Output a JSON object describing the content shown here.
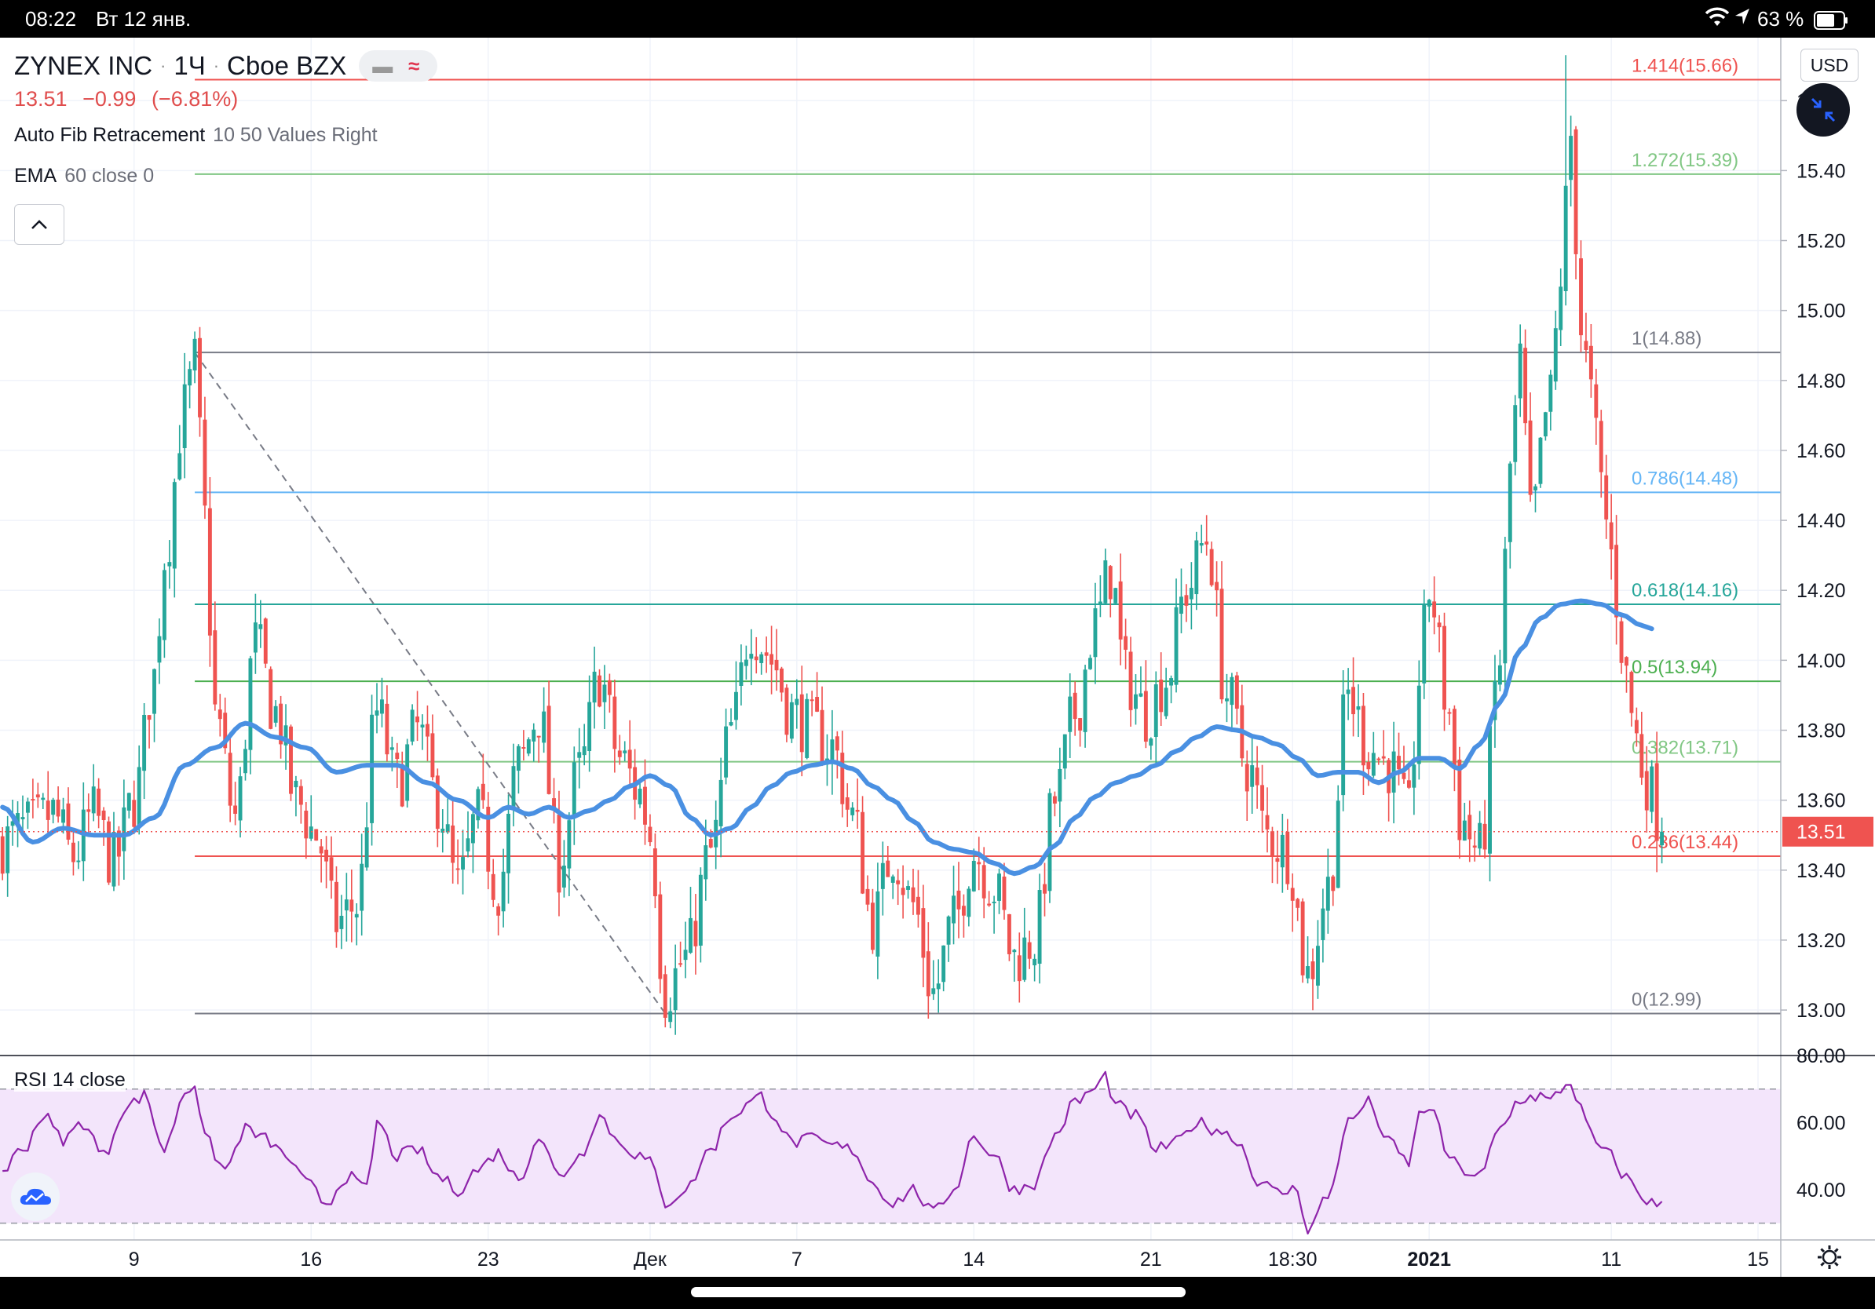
{
  "status_bar": {
    "time": "08:22",
    "date": "Вт 12 янв.",
    "battery": "63 %",
    "icons": [
      "wifi-icon",
      "location-arrow-icon",
      "battery-icon"
    ]
  },
  "header": {
    "symbol": "ZYNEX INC",
    "interval": "1Ч",
    "exchange": "Cboe BZX",
    "last_price": "13.51",
    "change": "−0.99",
    "change_pct": "(−6.81%)",
    "indicators": [
      {
        "name": "Auto Fib Retracement",
        "params": "10 50 Values Right"
      },
      {
        "name": "EMA",
        "params": "60 close 0"
      }
    ],
    "rsi": {
      "name": "RSI",
      "params": "14 close"
    }
  },
  "controls": {
    "currency": "USD",
    "collapse": "^"
  },
  "colors": {
    "up": "#26a69a",
    "down": "#ef5350",
    "ema": "#4a90e2",
    "rsi": "#8e24aa",
    "rsi_band": "#f3e5fb"
  },
  "chart_data": {
    "type": "candlestick",
    "title": "ZYNEX INC · 1Ч · Cboe BZX",
    "ylim": [
      12.87,
      15.78
    ],
    "y_ticks": [
      13.0,
      13.2,
      13.4,
      13.6,
      13.8,
      14.0,
      14.2,
      14.4,
      14.6,
      14.8,
      15.0,
      15.2,
      15.4,
      15.6
    ],
    "y_tick_labels": [
      "13.00",
      "13.20",
      "13.40",
      "13.60",
      "13.80",
      "14.00",
      "14.20",
      "14.40",
      "14.60",
      "14.80",
      "15.00",
      "15.20",
      "15.40",
      "15.60"
    ],
    "x_ticks": [
      {
        "label": "9",
        "bar": 26
      },
      {
        "label": "16",
        "bar": 61
      },
      {
        "label": "23",
        "bar": 96
      },
      {
        "label": "Дек",
        "bar": 128
      },
      {
        "label": "7",
        "bar": 157
      },
      {
        "label": "14",
        "bar": 192
      },
      {
        "label": "21",
        "bar": 227
      },
      {
        "label": "18:30",
        "bar": 255
      },
      {
        "label": "2021",
        "bar": 282,
        "bold": true
      },
      {
        "label": "11",
        "bar": 318
      },
      {
        "label": "15",
        "bar": 347
      }
    ],
    "last_price": 13.51,
    "last_price_label": "13.51",
    "fib_levels": [
      {
        "level": "1.414",
        "price": 15.66,
        "label": "1.414(15.66)",
        "color": "#ef5350"
      },
      {
        "level": "1.272",
        "price": 15.39,
        "label": "1.272(15.39)",
        "color": "#81c784"
      },
      {
        "level": "1",
        "price": 14.88,
        "label": "1(14.88)",
        "color": "#787b86"
      },
      {
        "level": "0.786",
        "price": 14.48,
        "label": "0.786(14.48)",
        "color": "#64b5f6"
      },
      {
        "level": "0.618",
        "price": 14.16,
        "label": "0.618(14.16)",
        "color": "#26a69a"
      },
      {
        "level": "0.5",
        "price": 13.94,
        "label": "0.5(13.94)",
        "color": "#4caf50"
      },
      {
        "level": "0.382",
        "price": 13.71,
        "label": "0.382(13.71)",
        "color": "#81c784"
      },
      {
        "level": "0.236",
        "price": 13.44,
        "label": "0.236(13.44)",
        "color": "#ef5350"
      },
      {
        "level": "0",
        "price": 12.99,
        "label": "0(12.99)",
        "color": "#787b86"
      }
    ],
    "fib_trend": {
      "from": {
        "bar": 38,
        "price": 14.88
      },
      "to": {
        "bar": 131,
        "price": 12.99
      }
    },
    "price_anchors": [
      [
        0,
        13.48
      ],
      [
        5,
        13.52
      ],
      [
        10,
        13.56
      ],
      [
        14,
        13.44
      ],
      [
        18,
        13.56
      ],
      [
        22,
        13.42
      ],
      [
        26,
        13.6
      ],
      [
        30,
        13.95
      ],
      [
        32,
        14.3
      ],
      [
        36,
        14.72
      ],
      [
        38,
        14.85
      ],
      [
        40,
        14.4
      ],
      [
        42,
        13.85
      ],
      [
        46,
        13.55
      ],
      [
        50,
        14.05
      ],
      [
        54,
        13.85
      ],
      [
        58,
        13.6
      ],
      [
        62,
        13.5
      ],
      [
        66,
        13.25
      ],
      [
        70,
        13.3
      ],
      [
        74,
        13.85
      ],
      [
        78,
        13.65
      ],
      [
        82,
        13.8
      ],
      [
        86,
        13.6
      ],
      [
        90,
        13.35
      ],
      [
        94,
        13.55
      ],
      [
        98,
        13.35
      ],
      [
        102,
        13.7
      ],
      [
        106,
        13.85
      ],
      [
        110,
        13.42
      ],
      [
        114,
        13.68
      ],
      [
        118,
        13.95
      ],
      [
        122,
        13.72
      ],
      [
        126,
        13.62
      ],
      [
        128,
        13.5
      ],
      [
        131,
        13.05
      ],
      [
        135,
        13.15
      ],
      [
        140,
        13.45
      ],
      [
        144,
        13.8
      ],
      [
        148,
        14.1
      ],
      [
        150,
        14.05
      ],
      [
        152,
        14.0
      ],
      [
        156,
        13.85
      ],
      [
        160,
        13.8
      ],
      [
        164,
        13.75
      ],
      [
        168,
        13.55
      ],
      [
        172,
        13.25
      ],
      [
        176,
        13.45
      ],
      [
        180,
        13.3
      ],
      [
        184,
        13.05
      ],
      [
        188,
        13.25
      ],
      [
        192,
        13.45
      ],
      [
        196,
        13.35
      ],
      [
        200,
        13.15
      ],
      [
        204,
        13.2
      ],
      [
        208,
        13.6
      ],
      [
        212,
        13.85
      ],
      [
        216,
        14.1
      ],
      [
        219,
        14.25
      ],
      [
        222,
        13.95
      ],
      [
        226,
        13.85
      ],
      [
        230,
        13.95
      ],
      [
        234,
        14.2
      ],
      [
        238,
        14.35
      ],
      [
        242,
        13.9
      ],
      [
        246,
        13.7
      ],
      [
        250,
        13.5
      ],
      [
        254,
        13.45
      ],
      [
        258,
        13.1
      ],
      [
        262,
        13.35
      ],
      [
        266,
        13.9
      ],
      [
        270,
        13.75
      ],
      [
        274,
        13.7
      ],
      [
        278,
        13.55
      ],
      [
        280,
        13.95
      ],
      [
        282,
        14.2
      ],
      [
        286,
        13.85
      ],
      [
        288,
        13.55
      ],
      [
        292,
        13.45
      ],
      [
        296,
        14.0
      ],
      [
        298,
        14.55
      ],
      [
        300,
        14.85
      ],
      [
        302,
        14.4
      ],
      [
        306,
        14.75
      ],
      [
        308,
        15.1
      ],
      [
        310,
        15.5
      ],
      [
        312,
        14.95
      ],
      [
        314,
        14.75
      ],
      [
        316,
        14.5
      ],
      [
        318,
        14.3
      ],
      [
        320,
        14.05
      ],
      [
        322,
        13.85
      ],
      [
        324,
        13.7
      ],
      [
        326,
        13.62
      ],
      [
        328,
        13.51
      ]
    ],
    "spike": {
      "bar": 309,
      "high": 15.73,
      "low": 14.9
    },
    "ema_anchors": [
      [
        0,
        13.58
      ],
      [
        6,
        13.48
      ],
      [
        12,
        13.52
      ],
      [
        18,
        13.5
      ],
      [
        24,
        13.5
      ],
      [
        30,
        13.55
      ],
      [
        36,
        13.7
      ],
      [
        42,
        13.75
      ],
      [
        48,
        13.82
      ],
      [
        54,
        13.78
      ],
      [
        60,
        13.75
      ],
      [
        66,
        13.68
      ],
      [
        72,
        13.7
      ],
      [
        78,
        13.7
      ],
      [
        84,
        13.65
      ],
      [
        90,
        13.6
      ],
      [
        96,
        13.55
      ],
      [
        100,
        13.58
      ],
      [
        104,
        13.56
      ],
      [
        108,
        13.58
      ],
      [
        112,
        13.55
      ],
      [
        116,
        13.57
      ],
      [
        120,
        13.6
      ],
      [
        124,
        13.64
      ],
      [
        128,
        13.67
      ],
      [
        132,
        13.64
      ],
      [
        136,
        13.55
      ],
      [
        140,
        13.5
      ],
      [
        144,
        13.52
      ],
      [
        148,
        13.58
      ],
      [
        152,
        13.64
      ],
      [
        156,
        13.68
      ],
      [
        160,
        13.7
      ],
      [
        164,
        13.71
      ],
      [
        168,
        13.69
      ],
      [
        172,
        13.64
      ],
      [
        176,
        13.6
      ],
      [
        180,
        13.54
      ],
      [
        184,
        13.48
      ],
      [
        188,
        13.46
      ],
      [
        192,
        13.45
      ],
      [
        196,
        13.42
      ],
      [
        200,
        13.39
      ],
      [
        204,
        13.41
      ],
      [
        208,
        13.47
      ],
      [
        212,
        13.55
      ],
      [
        216,
        13.61
      ],
      [
        220,
        13.65
      ],
      [
        224,
        13.67
      ],
      [
        228,
        13.7
      ],
      [
        232,
        13.74
      ],
      [
        236,
        13.78
      ],
      [
        240,
        13.81
      ],
      [
        244,
        13.8
      ],
      [
        248,
        13.78
      ],
      [
        252,
        13.76
      ],
      [
        256,
        13.72
      ],
      [
        260,
        13.67
      ],
      [
        264,
        13.68
      ],
      [
        268,
        13.68
      ],
      [
        272,
        13.65
      ],
      [
        276,
        13.68
      ],
      [
        280,
        13.72
      ],
      [
        284,
        13.72
      ],
      [
        288,
        13.69
      ],
      [
        292,
        13.76
      ],
      [
        296,
        13.88
      ],
      [
        300,
        14.03
      ],
      [
        304,
        14.12
      ],
      [
        308,
        14.16
      ],
      [
        312,
        14.17
      ],
      [
        316,
        14.16
      ],
      [
        320,
        14.13
      ],
      [
        324,
        14.1
      ],
      [
        326,
        14.09
      ]
    ],
    "rsi": {
      "ylim": [
        25,
        80
      ],
      "upper_band": 70,
      "lower_band": 30,
      "y_ticks": [
        40,
        60,
        80
      ],
      "y_tick_labels": [
        "40.00",
        "60.00",
        "80.00"
      ],
      "anchors": [
        [
          0,
          46
        ],
        [
          4,
          52
        ],
        [
          8,
          62
        ],
        [
          12,
          55
        ],
        [
          16,
          60
        ],
        [
          20,
          50
        ],
        [
          24,
          64
        ],
        [
          28,
          68
        ],
        [
          32,
          52
        ],
        [
          36,
          69
        ],
        [
          38,
          72
        ],
        [
          40,
          55
        ],
        [
          44,
          46
        ],
        [
          48,
          58
        ],
        [
          52,
          55
        ],
        [
          56,
          50
        ],
        [
          60,
          42
        ],
        [
          64,
          36
        ],
        [
          68,
          44
        ],
        [
          72,
          40
        ],
        [
          74,
          60
        ],
        [
          78,
          50
        ],
        [
          82,
          52
        ],
        [
          86,
          44
        ],
        [
          90,
          40
        ],
        [
          94,
          46
        ],
        [
          98,
          51
        ],
        [
          102,
          43
        ],
        [
          106,
          56
        ],
        [
          110,
          44
        ],
        [
          114,
          50
        ],
        [
          118,
          62
        ],
        [
          122,
          54
        ],
        [
          126,
          50
        ],
        [
          128,
          48
        ],
        [
          131,
          36
        ],
        [
          135,
          40
        ],
        [
          140,
          52
        ],
        [
          144,
          62
        ],
        [
          148,
          66
        ],
        [
          150,
          68
        ],
        [
          152,
          63
        ],
        [
          156,
          54
        ],
        [
          160,
          55
        ],
        [
          164,
          53
        ],
        [
          168,
          52
        ],
        [
          172,
          42
        ],
        [
          176,
          36
        ],
        [
          180,
          40
        ],
        [
          184,
          33
        ],
        [
          188,
          40
        ],
        [
          192,
          56
        ],
        [
          196,
          50
        ],
        [
          200,
          40
        ],
        [
          204,
          42
        ],
        [
          208,
          56
        ],
        [
          212,
          66
        ],
        [
          216,
          70
        ],
        [
          218,
          74
        ],
        [
          220,
          65
        ],
        [
          224,
          62
        ],
        [
          228,
          52
        ],
        [
          232,
          54
        ],
        [
          236,
          60
        ],
        [
          240,
          58
        ],
        [
          244,
          55
        ],
        [
          248,
          43
        ],
        [
          252,
          39
        ],
        [
          256,
          40
        ],
        [
          258,
          28
        ],
        [
          262,
          38
        ],
        [
          266,
          60
        ],
        [
          270,
          66
        ],
        [
          274,
          54
        ],
        [
          278,
          48
        ],
        [
          280,
          62
        ],
        [
          282,
          65
        ],
        [
          286,
          50
        ],
        [
          288,
          46
        ],
        [
          292,
          44
        ],
        [
          296,
          58
        ],
        [
          300,
          67
        ],
        [
          304,
          68
        ],
        [
          306,
          66
        ],
        [
          308,
          70
        ],
        [
          310,
          72
        ],
        [
          312,
          64
        ],
        [
          314,
          56
        ],
        [
          316,
          52
        ],
        [
          318,
          50
        ],
        [
          320,
          45
        ],
        [
          322,
          42
        ],
        [
          324,
          38
        ],
        [
          326,
          36
        ],
        [
          328,
          35
        ]
      ]
    }
  }
}
